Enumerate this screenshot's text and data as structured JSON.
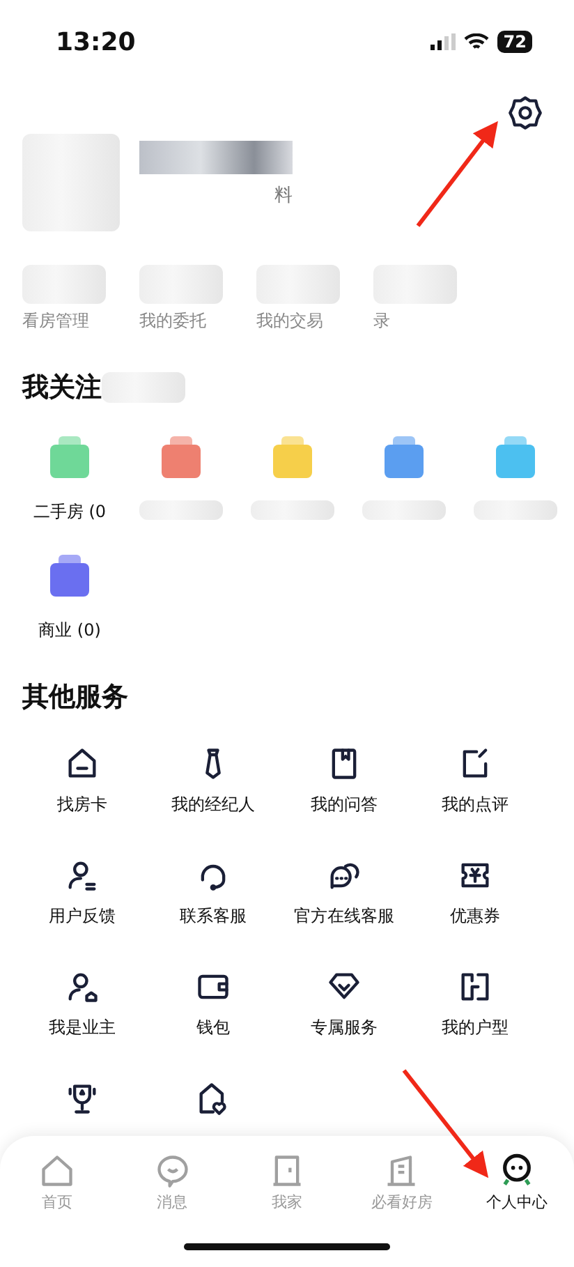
{
  "status_bar": {
    "time": "13:20",
    "battery": "72"
  },
  "profile": {
    "link_fragment": "料"
  },
  "stats": [
    {
      "label": "看房管理"
    },
    {
      "label": "我的委托"
    },
    {
      "label": "我的交易"
    },
    {
      "label": "录"
    }
  ],
  "follow": {
    "title": "我关注",
    "items": [
      {
        "kind": "label",
        "label": "二手房 (0",
        "color": "#6fd898"
      },
      {
        "kind": "redacted",
        "color": "#ee8070"
      },
      {
        "kind": "redacted",
        "color": "#f6cf4a"
      },
      {
        "kind": "redacted",
        "color": "#5b9ef0"
      },
      {
        "kind": "redacted",
        "color": "#4cc0f0"
      },
      {
        "kind": "label",
        "label": "商业 (0)",
        "color": "#6a6ff0"
      }
    ]
  },
  "services": {
    "title": "其他服务",
    "items": [
      {
        "kind": "labeled",
        "label": "找房卡"
      },
      {
        "kind": "labeled",
        "label": "我的经纪人"
      },
      {
        "kind": "labeled",
        "label": "我的问答"
      },
      {
        "kind": "labeled",
        "label": "我的点评"
      },
      {
        "kind": "labeled",
        "label": "用户反馈"
      },
      {
        "kind": "labeled",
        "label": "联系客服"
      },
      {
        "kind": "labeled",
        "label": "官方在线客服"
      },
      {
        "kind": "labeled",
        "label": "优惠券"
      },
      {
        "kind": "labeled",
        "label": "我是业主"
      },
      {
        "kind": "labeled",
        "label": "钱包"
      },
      {
        "kind": "labeled",
        "label": "专属服务"
      },
      {
        "kind": "labeled",
        "label": "我的户型"
      },
      {
        "kind": "icon_only"
      },
      {
        "kind": "icon_only"
      }
    ]
  },
  "tabs": [
    {
      "label": "首页",
      "selected": false
    },
    {
      "label": "消息",
      "selected": false
    },
    {
      "label": "我家",
      "selected": false
    },
    {
      "label": "必看好房",
      "selected": false
    },
    {
      "label": "个人中心",
      "selected": true
    }
  ]
}
